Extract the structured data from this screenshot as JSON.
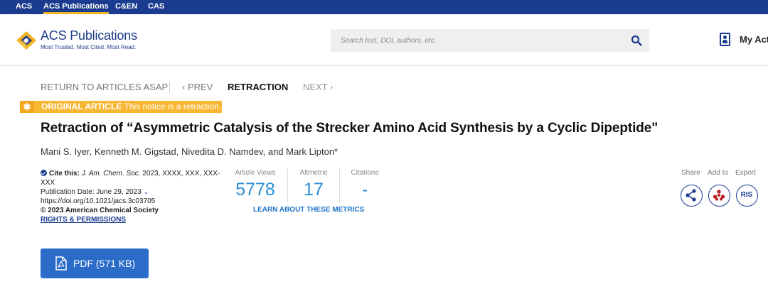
{
  "topbar": {
    "items": [
      "ACS",
      "ACS Publications",
      "C&EN",
      "CAS"
    ],
    "active": "ACS Publications"
  },
  "header": {
    "brand": "ACS Publications",
    "tagline": "Most Trusted. Most Cited. Most Read.",
    "search_placeholder": "Search text, DOI, authors, etc.",
    "account_label": "My Acti"
  },
  "article_nav": {
    "back": "RETURN TO ARTICLES ASAP",
    "prev": "‹ PREV",
    "current": "RETRACTION",
    "next": "NEXT ›"
  },
  "notice": {
    "icon": "asterisk-icon",
    "label": "ORIGINAL ARTICLE",
    "text": "This notice is a retraction."
  },
  "article": {
    "title": "Retraction of “Asymmetric Catalysis of the Strecker Amino Acid Synthesis by a Cyclic Dipeptide\"",
    "authors": "Mani S. Iyer, Kenneth M. Gigstad, Nivedita D. Namdev, and Mark Lipton*"
  },
  "citation": {
    "cite_label": "Cite this:",
    "journal": "J. Am. Chem. Soc.",
    "ref_line1": " 2023, XXXX, XXX, XXX-",
    "ref_line2": "XXX",
    "pub_date": "Publication Date: June 29, 2023",
    "doi": "https://doi.org/10.1021/jacs.3c03705",
    "copyright": "© 2023 American Chemical Society",
    "rights": "RIGHTS & PERMISSIONS"
  },
  "metrics": {
    "views_label": "Article Views",
    "views": "5778",
    "altmetric_label": "Altmetric",
    "altmetric": "17",
    "citations_label": "Citations",
    "citations": "-",
    "learn_more": "LEARN ABOUT THESE METRICS"
  },
  "actions": {
    "share": "Share",
    "add_to": "Add to",
    "export": "Export",
    "export_button": "RIS"
  },
  "pdf": {
    "label": "PDF (571 KB)"
  },
  "colors": {
    "topbar": "#1a3b8f",
    "accent": "#f7b733",
    "metric": "#2a8fd6",
    "pdf_button": "#2b6cc9"
  }
}
